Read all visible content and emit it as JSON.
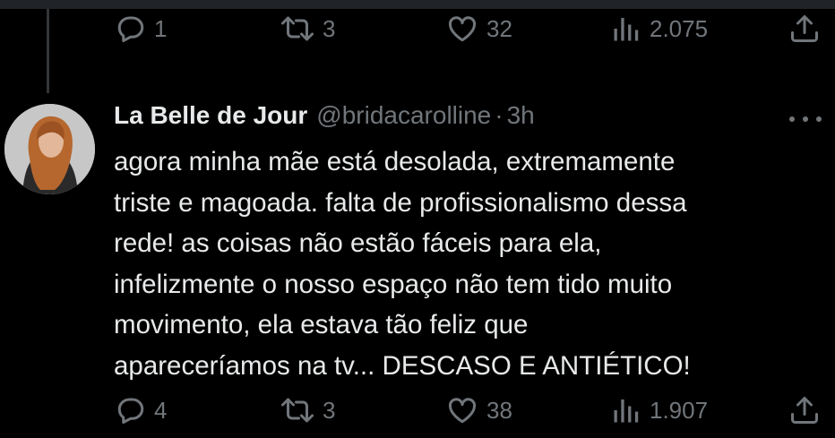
{
  "prev_tweet": {
    "actions": {
      "replies": "1",
      "retweets": "3",
      "likes": "32",
      "views": "2.075"
    }
  },
  "tweet": {
    "author_name": "La Belle de Jour",
    "handle": "@bridacarolline",
    "separator": "·",
    "time": "3h",
    "text": "agora minha mãe está desolada, extremamente\ntriste e magoada. falta de profissionalismo dessa\nrede! as coisas  não estão fáceis para ela,\ninfelizmente o nosso espaço não tem tido muito\nmovimento, ela estava tão feliz que\napareceríamos na tv... DESCASO E ANTIÉTICO!",
    "actions": {
      "replies": "4",
      "retweets": "3",
      "likes": "38",
      "views": "1.907"
    }
  },
  "icons": [
    "reply-icon",
    "retweet-icon",
    "like-icon",
    "views-icon",
    "share-icon",
    "more-icon"
  ],
  "colors": {
    "background": "#000000",
    "text": "#e7e9ea",
    "muted": "#71767b",
    "thread_line": "#333639"
  }
}
